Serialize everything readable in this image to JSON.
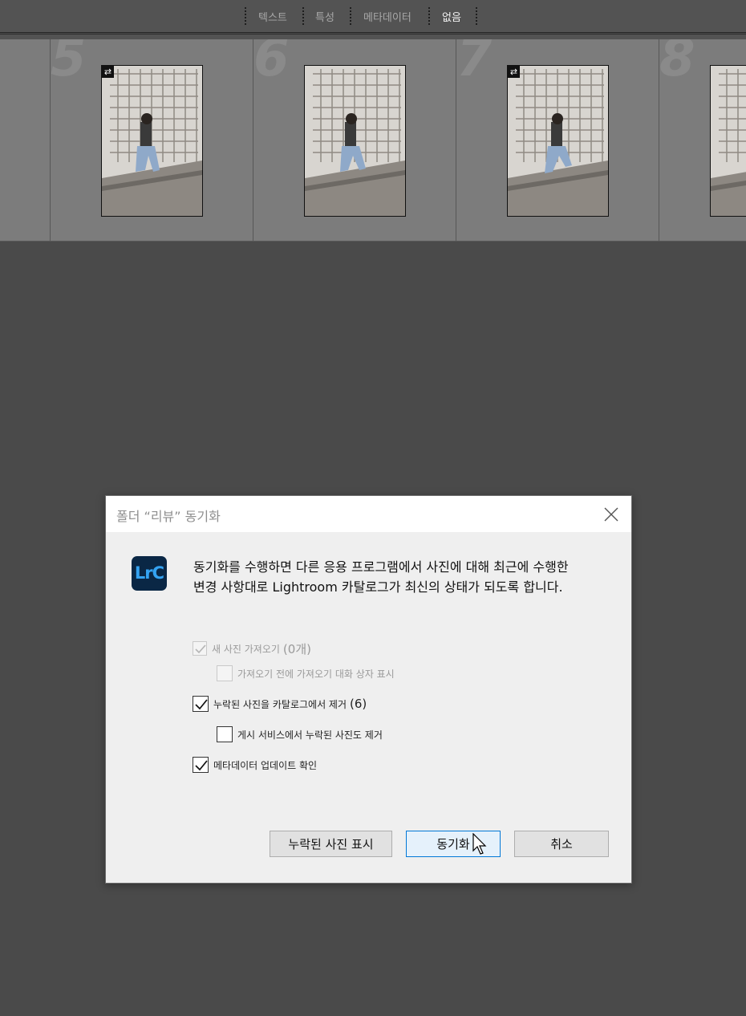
{
  "filter_bar": {
    "items": [
      {
        "label": "텍스트",
        "active": false
      },
      {
        "label": "특성",
        "active": false
      },
      {
        "label": "메타데이터",
        "active": false
      },
      {
        "label": "없음",
        "active": true
      }
    ]
  },
  "grid": {
    "cells": [
      {
        "number": "",
        "has_thumbnail": false,
        "sync_badge": false
      },
      {
        "number": "5",
        "has_thumbnail": true,
        "sync_badge": true
      },
      {
        "number": "6",
        "has_thumbnail": true,
        "sync_badge": false
      },
      {
        "number": "7",
        "has_thumbnail": true,
        "sync_badge": true
      },
      {
        "number": "8",
        "has_thumbnail": true,
        "sync_badge": false
      }
    ]
  },
  "dialog": {
    "title": "폴더 “리뷰” 동기화",
    "app_icon_text": "LrC",
    "message_line1": "동기화를 수행하면 다른 응용 프로그램에서 사진에 대해 최근에 수행한",
    "message_line2": "변경 사항대로 Lightroom 카탈로그가 최신의 상태가 되도록 합니다.",
    "options": {
      "import_new": {
        "label": "새 사진 가져오기",
        "count": "(0개)",
        "checked": true,
        "enabled": false
      },
      "show_import_dialog": {
        "label": "가져오기 전에 가져오기 대화 상자 표시",
        "checked": false,
        "enabled": false
      },
      "remove_missing": {
        "label": "누락된 사진을 카탈로그에서 제거",
        "count": "(6)",
        "checked": true,
        "enabled": true
      },
      "remove_missing_publish": {
        "label": "게시 서비스에서 누락된 사진도 제거",
        "checked": false,
        "enabled": true
      },
      "scan_metadata": {
        "label": "메타데이터 업데이트 확인",
        "checked": true,
        "enabled": true
      }
    },
    "buttons": {
      "show_missing": "누락된 사진 표시",
      "synchronize": "동기화",
      "cancel": "취소"
    }
  },
  "colors": {
    "background": "#4a4a4a",
    "grid_cell": "#7c7c7c",
    "dialog_bg": "#efefef",
    "primary_border": "#0078d7",
    "lrc_bg": "#0a2745",
    "lrc_text": "#34a3f2"
  }
}
